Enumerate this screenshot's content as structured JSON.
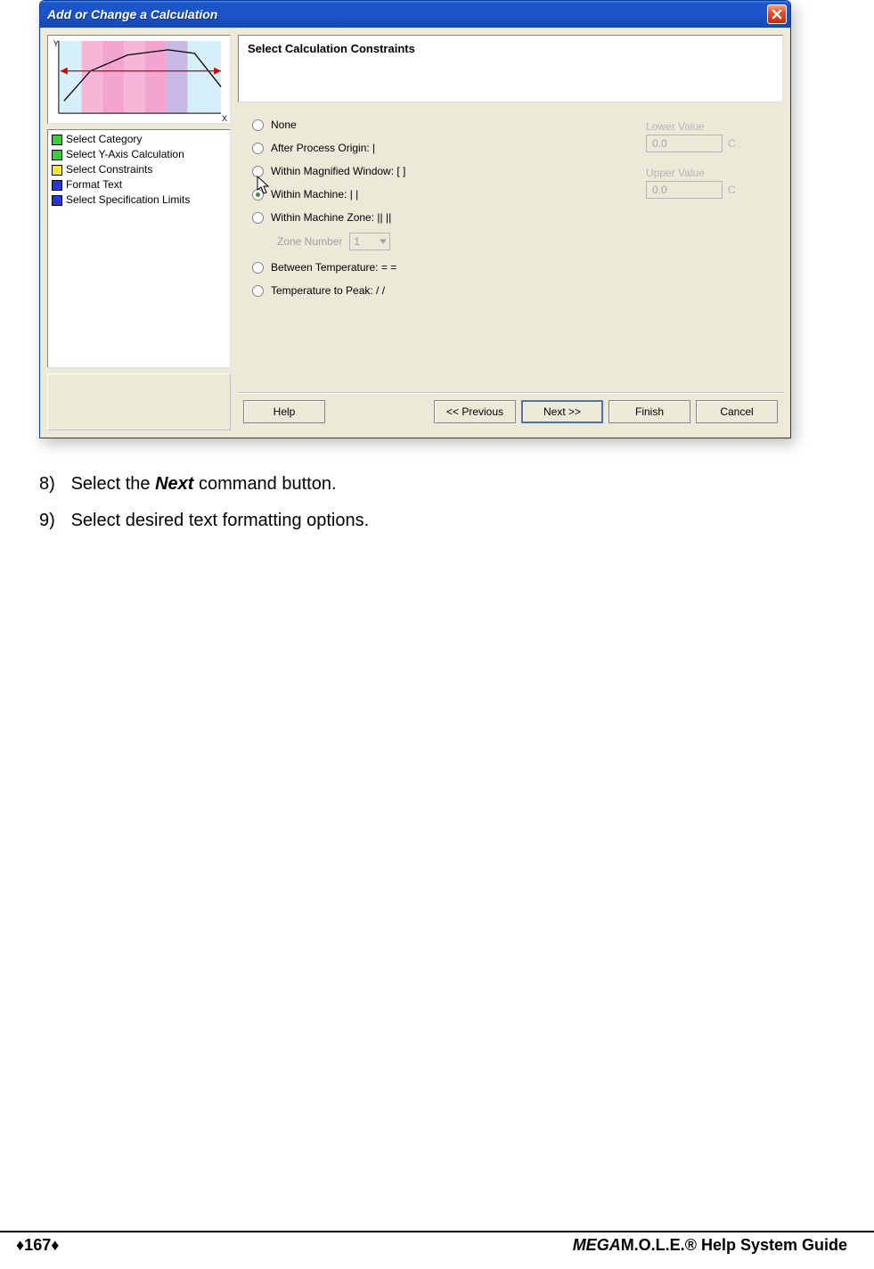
{
  "dialog": {
    "title": "Add or Change a Calculation",
    "heading": "Select Calculation Constraints",
    "steps": [
      {
        "color": "#3acc3a",
        "label": "Select Category"
      },
      {
        "color": "#3acc3a",
        "label": "Select Y-Axis Calculation"
      },
      {
        "color": "#f2e63a",
        "label": "Select Constraints"
      },
      {
        "color": "#2936d6",
        "label": "Format Text"
      },
      {
        "color": "#2936d6",
        "label": "Select Specification Limits"
      }
    ],
    "radios": [
      {
        "label": "None",
        "selected": false
      },
      {
        "label": "After Process Origin: |",
        "selected": false
      },
      {
        "label": "Within Magnified Window: [  ]",
        "selected": false
      },
      {
        "label": "Within Machine: |  |",
        "selected": true
      },
      {
        "label": "Within Machine Zone: ||  ||",
        "selected": false
      },
      {
        "label": "Between Temperature: =  =",
        "selected": false
      },
      {
        "label": "Temperature to Peak: /  /",
        "selected": false
      }
    ],
    "zone": {
      "label": "Zone Number",
      "value": "1"
    },
    "lower": {
      "label": "Lower Value",
      "value": "0.0",
      "unit": "C"
    },
    "upper": {
      "label": "Upper Value",
      "value": "0.0",
      "unit": "C"
    },
    "buttons": {
      "help": "Help",
      "prev": "<< Previous",
      "next": "Next >>",
      "finish": "Finish",
      "cancel": "Cancel"
    }
  },
  "doc": {
    "line8_num": "8)",
    "line8_a": "Select the ",
    "line8_b": "Next",
    "line8_c": " command button.",
    "line9_num": "9)",
    "line9": "Select desired text formatting options."
  },
  "footer": {
    "page": "♦167♦",
    "mega": "MEGA",
    "rest": "M.O.L.E.® Help System Guide"
  }
}
